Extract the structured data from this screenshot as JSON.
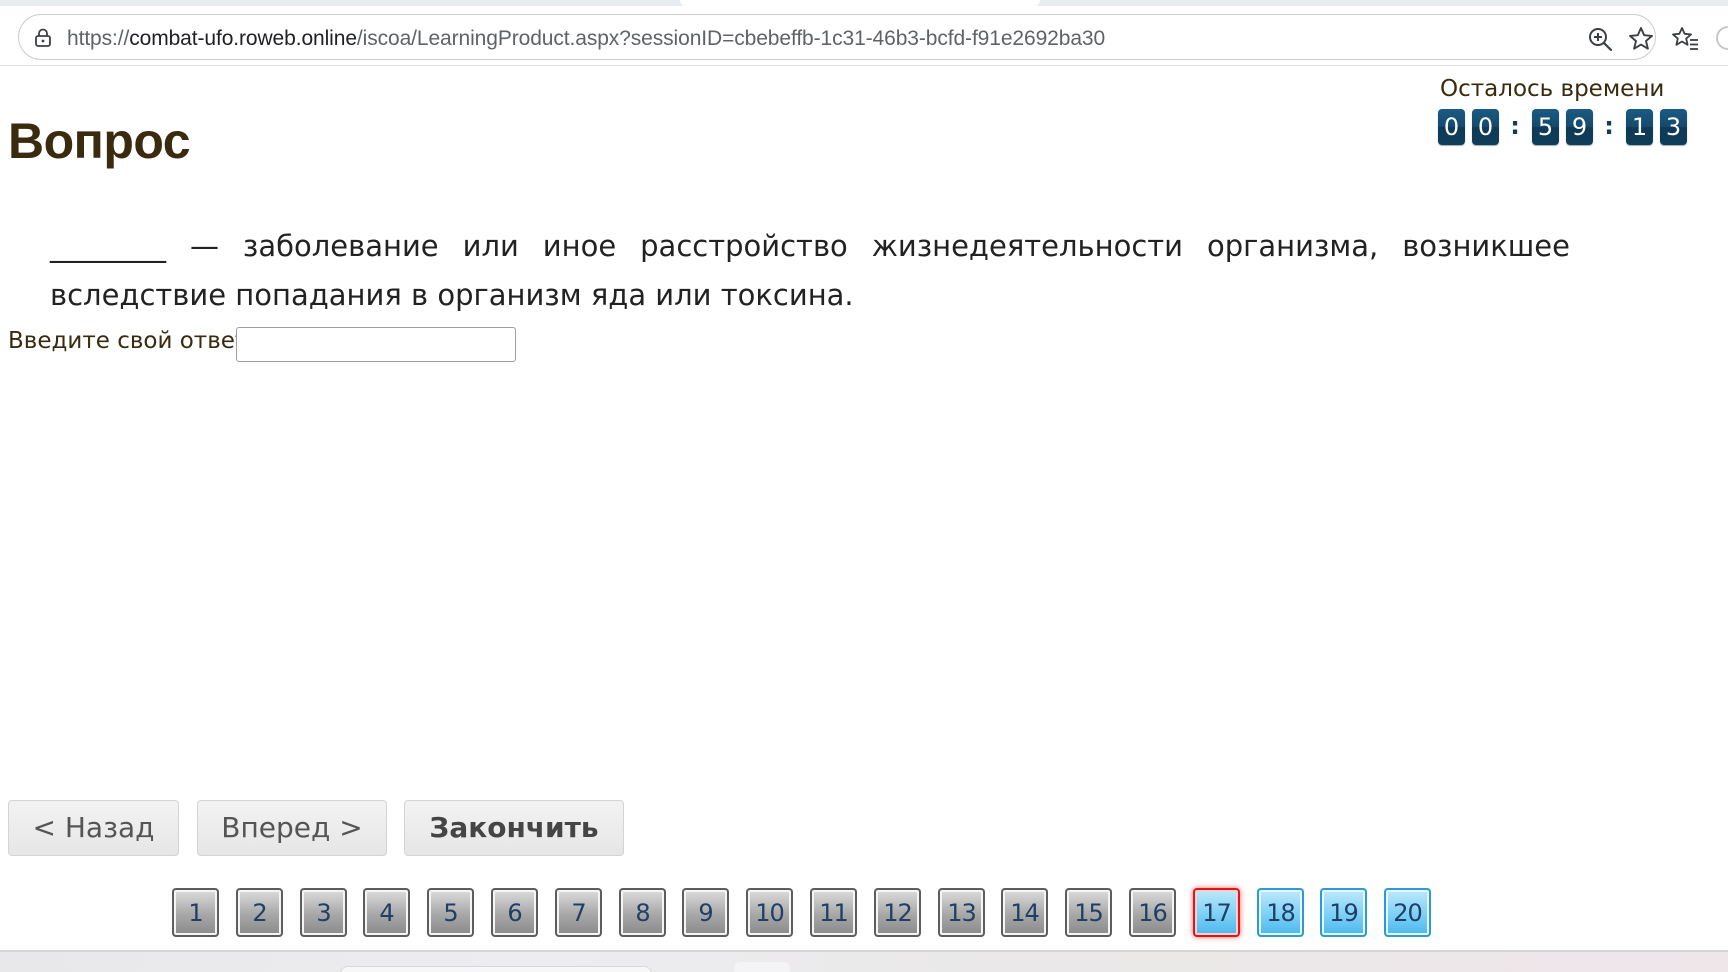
{
  "browser": {
    "url_scheme": "https://",
    "url_host": "combat-ufo.roweb.online",
    "url_path": "/iscoa/LearningProduct.aspx?sessionID=cbebeffb-1c31-46b3-bcfd-f91e2692ba30"
  },
  "header": {
    "title": "Вопрос",
    "timer_label": "Осталось времени",
    "timer_digits": [
      "0",
      "0",
      "5",
      "9",
      "1",
      "3"
    ],
    "timer_separator": ":"
  },
  "question": {
    "text": "________ — заболевание или иное расстройство жизнедеятельности организма, возникшее вследствие попадания в организм яда или токсина.",
    "answer_label": "Введите свой ответ",
    "answer_value": "",
    "answer_placeholder": ""
  },
  "nav": {
    "back_label": "< Назад",
    "forward_label": "Вперед >",
    "finish_label": "Закончить"
  },
  "pager": {
    "current": 17,
    "items": [
      "1",
      "2",
      "3",
      "4",
      "5",
      "6",
      "7",
      "8",
      "9",
      "10",
      "11",
      "12",
      "13",
      "14",
      "15",
      "16",
      "17",
      "18",
      "19",
      "20"
    ]
  },
  "colors": {
    "title": "#3a2a0e",
    "timer_digit_bg": "#154a6c",
    "pager_current_border": "#e0141b",
    "pager_future_bg": "#7cd0f5",
    "pager_past_bg": "#a7a7a7"
  }
}
